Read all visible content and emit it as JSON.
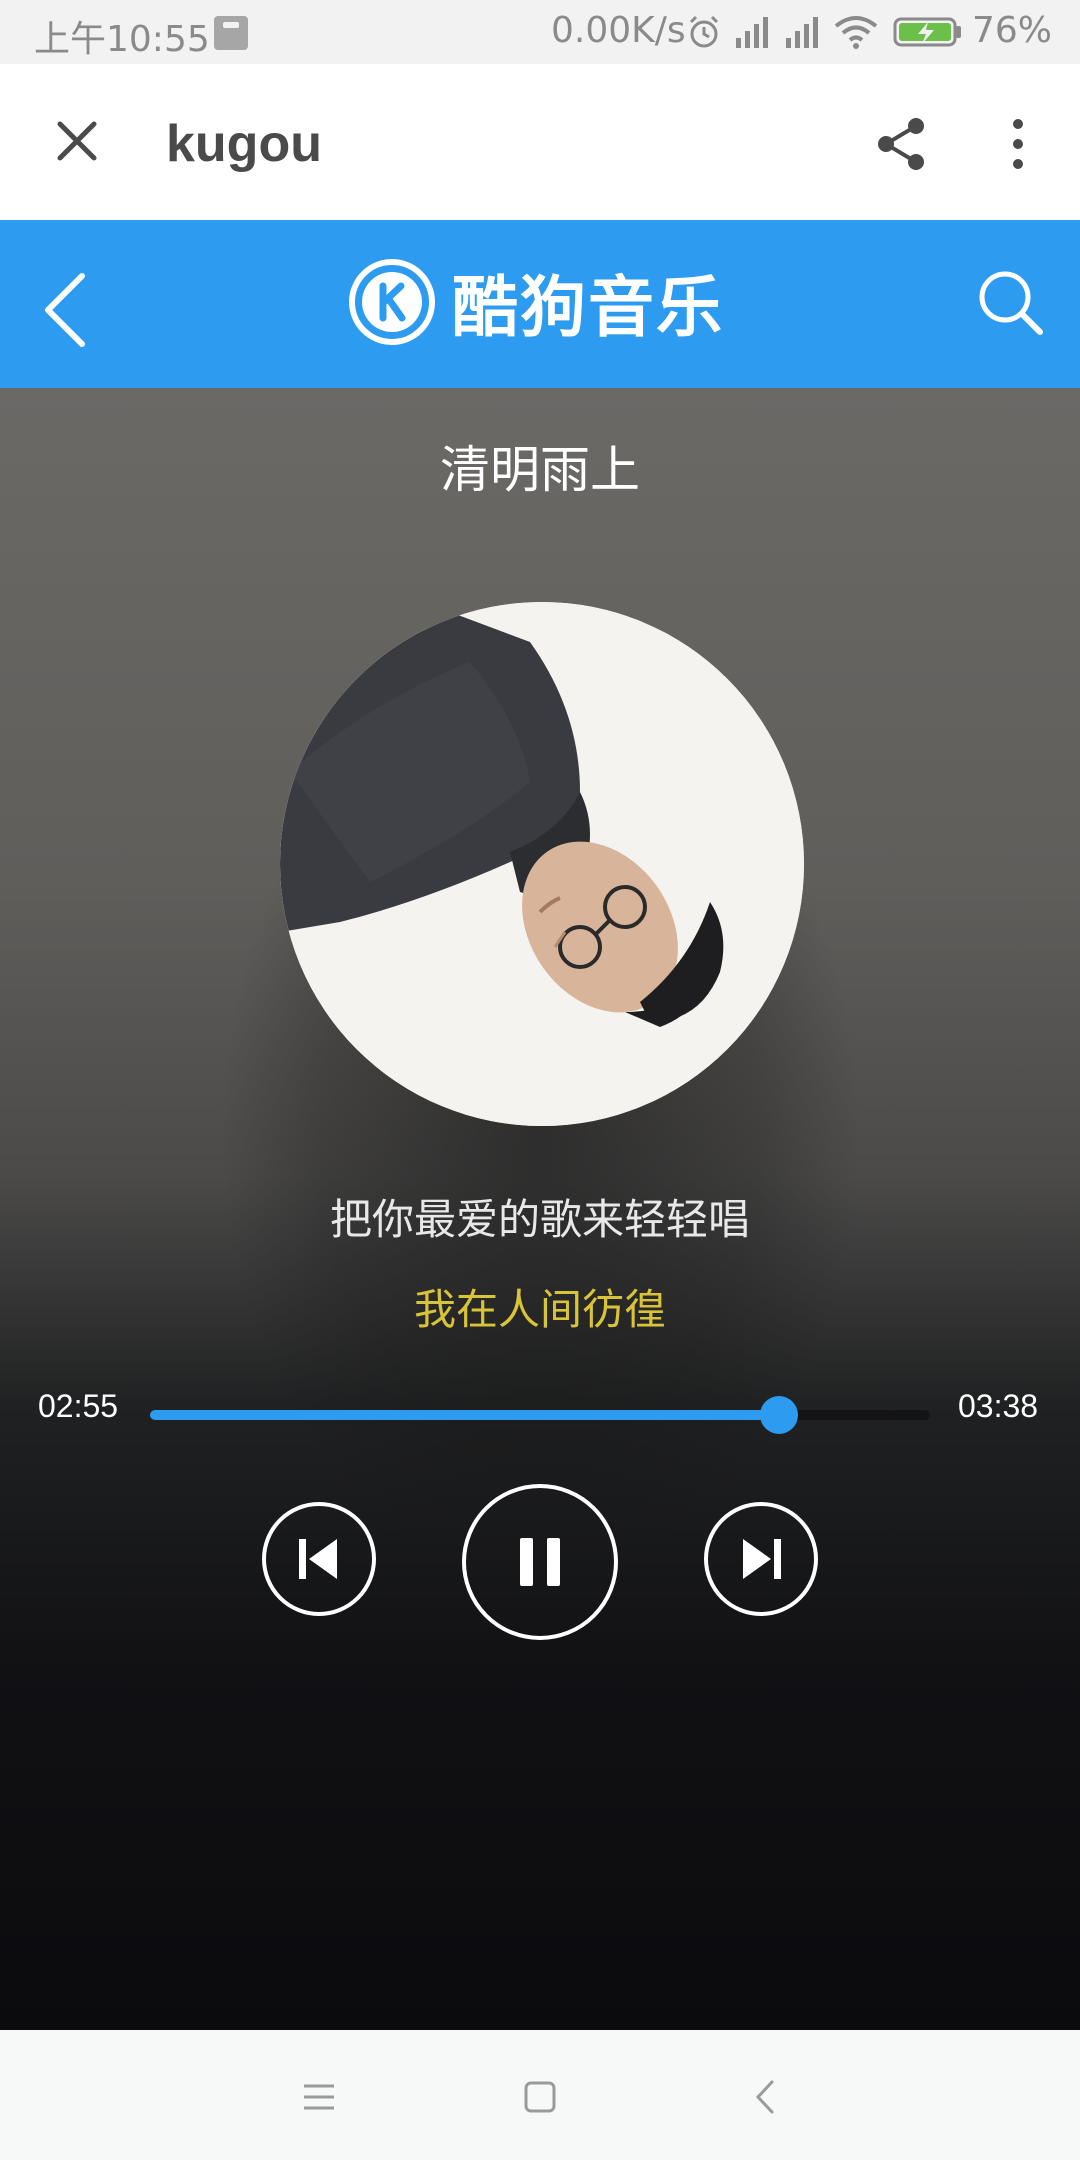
{
  "status_bar": {
    "time": "上午10:55",
    "network_speed": "0.00K/s",
    "battery_percent": "76%",
    "icons": [
      "mi-icon",
      "alarm-icon",
      "signal-icon",
      "signal-icon",
      "wifi-icon",
      "battery-charging-icon"
    ]
  },
  "browser": {
    "title": "kugou",
    "icons": [
      "close-icon",
      "share-icon",
      "more-vertical-icon"
    ]
  },
  "app_header": {
    "logo_text": "酷狗音乐",
    "icons": [
      "back-arrow-icon",
      "kugou-logo-icon",
      "search-icon"
    ],
    "accent_color": "#2d9cf0"
  },
  "player": {
    "song_title": "清明雨上",
    "lyric_current": "把你最爱的歌来轻轻唱",
    "lyric_next": "我在人间彷徨",
    "lyric_next_color": "#d9c438",
    "time_current": "02:55",
    "time_total": "03:38",
    "progress_fraction": 0.806,
    "controls": [
      "previous-icon",
      "pause-icon",
      "next-icon"
    ]
  },
  "nav_bar": {
    "icons": [
      "menu-icon",
      "home-square-icon",
      "back-chevron-icon"
    ]
  }
}
